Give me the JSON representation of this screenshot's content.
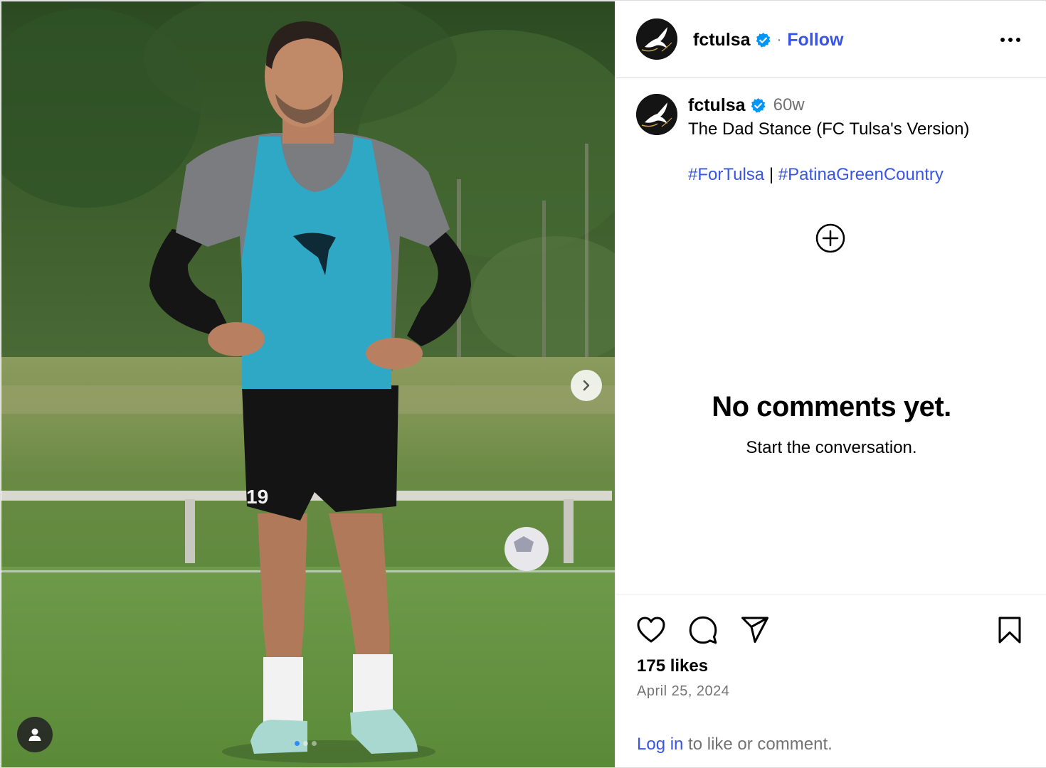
{
  "post": {
    "username": "fctulsa",
    "follow_label": "Follow",
    "separator": "·",
    "time_ago": "60w",
    "caption": "The Dad Stance (FC Tulsa's Version)",
    "hashtags": [
      "#ForTulsa",
      "#PatinaGreenCountry"
    ],
    "hashtag_separator": "|",
    "jersey_number_shown": "19"
  },
  "comments": {
    "empty_title": "No comments yet.",
    "empty_subtitle": "Start the conversation."
  },
  "footer": {
    "likes": "175 likes",
    "date": "April 25, 2024",
    "login_link": "Log in",
    "login_rest": " to like or comment."
  },
  "carousel": {
    "count": 3,
    "active_index": 0
  },
  "icons": [
    "verified-icon",
    "more-options-icon",
    "add-comment-icon",
    "heart-icon",
    "comment-icon",
    "share-icon",
    "bookmark-icon",
    "chevron-right-icon",
    "user-tag-icon"
  ],
  "colors": {
    "link": "#3a55e5",
    "verified": "#0095f6",
    "muted": "#737373",
    "border": "#dbdbdb"
  }
}
